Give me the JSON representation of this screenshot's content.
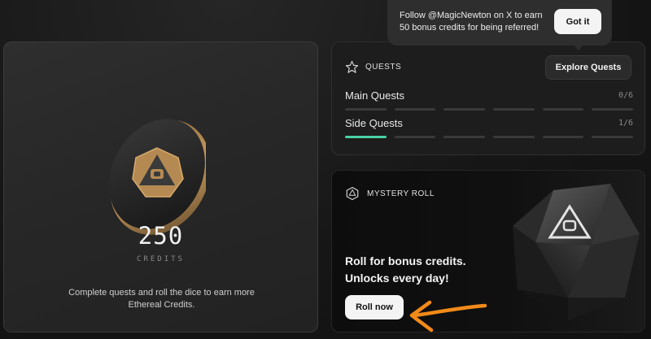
{
  "credits": {
    "value": "250",
    "unit_label": "CREDITS",
    "description": "Complete quests and roll the dice to earn more Ethereal Credits."
  },
  "quests": {
    "title": "QUESTS",
    "icon": "star-icon",
    "explore_button": "Explore Quests",
    "rows": [
      {
        "name": "Main Quests",
        "count": "0/6",
        "completed": 0,
        "total": 6
      },
      {
        "name": "Side Quests",
        "count": "1/6",
        "completed": 1,
        "total": 6
      }
    ],
    "progress_color": "#47d2a8"
  },
  "mystery_roll": {
    "title": "MYSTERY ROLL",
    "icon": "d20-icon",
    "line1": "Roll for bonus credits.",
    "line2": "Unlocks every day!",
    "button": "Roll now"
  },
  "toast": {
    "line1": "Follow @MagicNewton on X to earn",
    "line2": "50 bonus credits for being referred!",
    "button": "Got it"
  },
  "annotation": {
    "arrow_color": "#f28a1a"
  }
}
